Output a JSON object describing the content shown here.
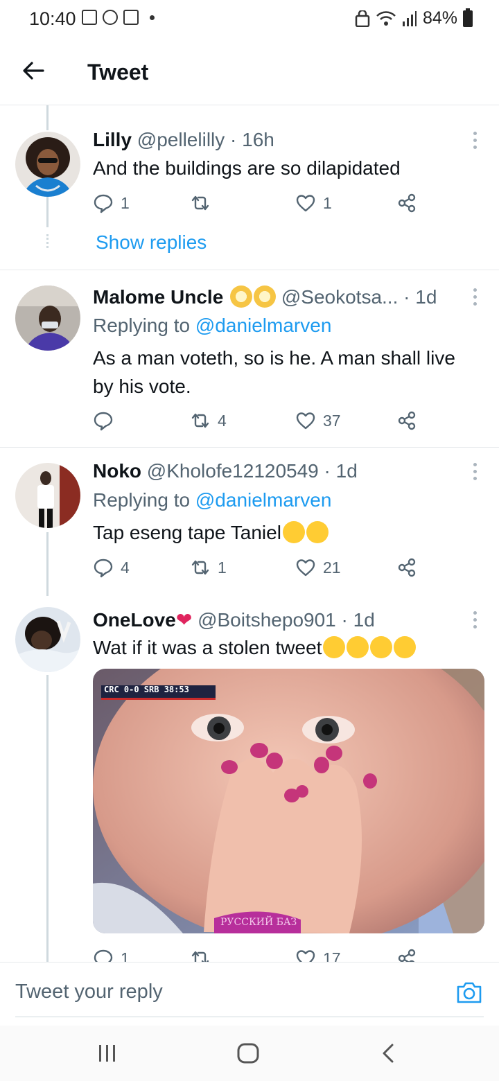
{
  "status_bar": {
    "time": "10:40",
    "battery": "84%"
  },
  "header": {
    "title": "Tweet"
  },
  "tweets": [
    {
      "name": "Lilly",
      "handle": "@pellelilly",
      "time": "· 16h",
      "text": "And the buildings are so dilapidated",
      "replies": "1",
      "retweets": "",
      "likes": "1",
      "show_replies": "Show replies"
    },
    {
      "name": "Malome Uncle",
      "handle": "@Seokotsa...",
      "time": "· 1d",
      "replying_prefix": "Replying to",
      "replying_to": "@danielmarven",
      "text": "As a man voteth, so is he. A man shall live by his vote.",
      "replies": "",
      "retweets": "4",
      "likes": "37"
    },
    {
      "name": "Noko",
      "handle": "@Kholofe12120549",
      "time": "· 1d",
      "replying_prefix": "Replying to",
      "replying_to": "@danielmarven",
      "text": "Tap eseng tape Taniel",
      "replies": "4",
      "retweets": "1",
      "likes": "21"
    },
    {
      "name": "OneLove",
      "handle": "@Boitshepo901",
      "time": "· 1d",
      "text": "Wat if it was a stolen tweet",
      "replies": "1",
      "retweets": "",
      "likes": "17",
      "media_scoreboard": "CRC 0-0 SRB 38:53",
      "media_caption": "РУССКИЙ БАЗ"
    }
  ],
  "reply_bar": {
    "placeholder": "Tweet your reply"
  },
  "icons": {
    "back": "arrow-left-icon",
    "reply": "comment-icon",
    "retweet": "retweet-icon",
    "like": "heart-icon",
    "share": "share-icon",
    "camera": "camera-icon"
  },
  "colors": {
    "accent": "#1d9bf0",
    "secondary_text": "#536471"
  }
}
